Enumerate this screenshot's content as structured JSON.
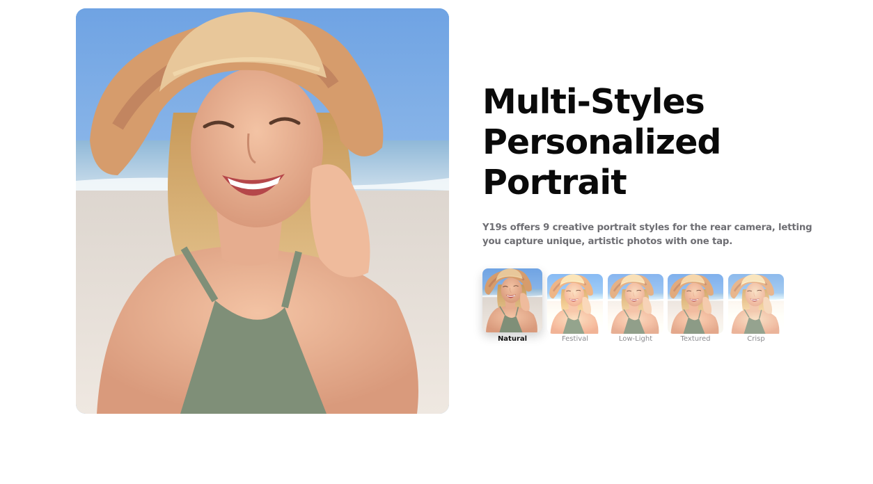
{
  "heading": {
    "line1": "Multi-Styles",
    "line2": "Personalized",
    "line3": "Portrait"
  },
  "description": "Y19s offers 9 creative portrait styles for the rear camera, letting you capture unique, artistic photos with one tap.",
  "portrait_styles": [
    {
      "label": "Natural",
      "selected": true
    },
    {
      "label": "Festival",
      "selected": false
    },
    {
      "label": "Low-Light",
      "selected": false
    },
    {
      "label": "Textured",
      "selected": false
    },
    {
      "label": "Crisp",
      "selected": false
    }
  ],
  "colors": {
    "heading": "#0a0a0a",
    "description": "#6e6e73",
    "label_active": "#111111",
    "label_inactive": "#8a8a8e"
  }
}
